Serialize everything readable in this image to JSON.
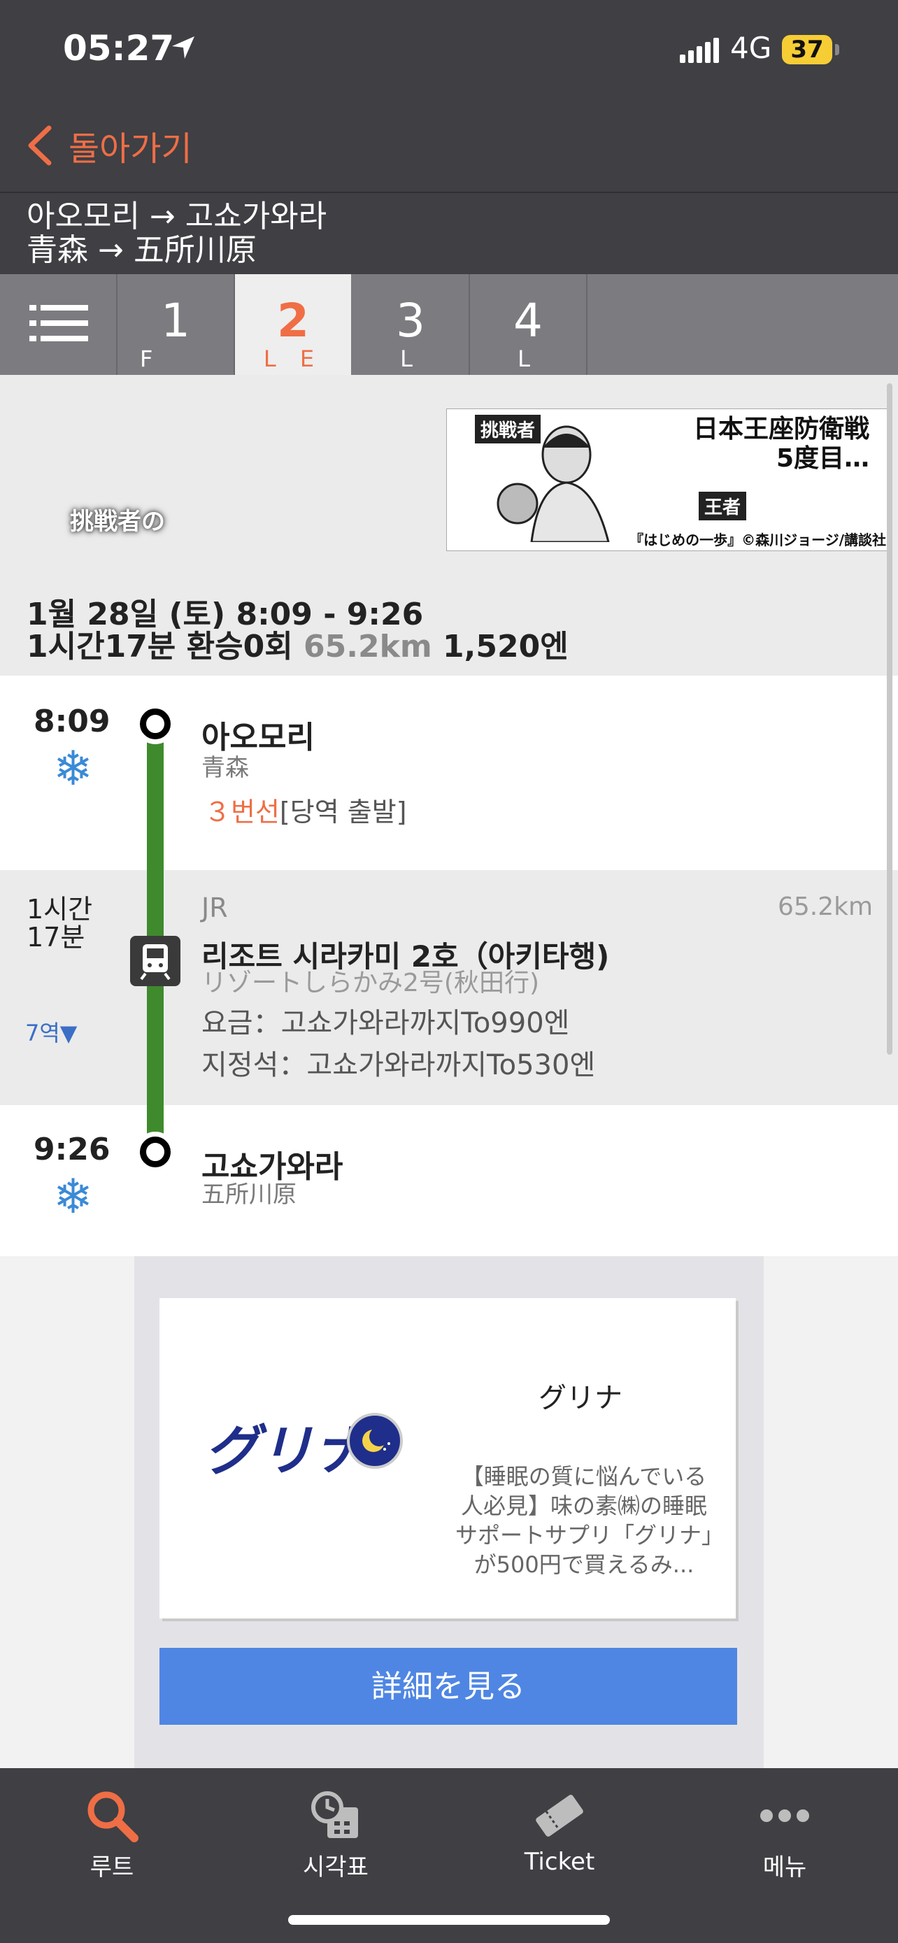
{
  "status_bar": {
    "time": "05:27",
    "network": "4G",
    "battery": "37"
  },
  "nav": {
    "back_label": "돌아가기"
  },
  "route_header": {
    "line_ko": "아오모리 → 고쇼가와라",
    "line_ja": "青森 → 五所川原"
  },
  "tabs": [
    {
      "num": "1",
      "sub": "F"
    },
    {
      "num": "2",
      "sub": "L E"
    },
    {
      "num": "3",
      "sub": "L"
    },
    {
      "num": "4",
      "sub": "L"
    }
  ],
  "active_tab": 2,
  "banner": {
    "tag_challenger": "挑戦者",
    "headline": "日本王座防衛戦\n5度目…",
    "tag_champion": "王者",
    "credit": "『はじめの一歩』©森川ジョージ/講談社",
    "overlay_text": "挑戦者の"
  },
  "summary": {
    "date_time": "1월 28일 (토)  8:09 -  9:26",
    "duration": "1시간17분",
    "transfers": "환승0회",
    "distance": "65.2km",
    "fare": "1,520엔"
  },
  "departure": {
    "time": "8:09",
    "weather_icon": "snowflake-icon",
    "station_ko": "아오모리",
    "station_ja": "青森",
    "platform_highlight": "３번선",
    "platform_note": "[당역 출발]"
  },
  "segment": {
    "duration_line1": "1시간",
    "duration_line2": "17분",
    "stops": "7역▼",
    "operator": "JR",
    "distance": "65.2km",
    "train_name": "리조트 시라카미 2호（아키타행)",
    "train_name_ja": "リゾートしらかみ2号(秋田行)",
    "fare": "요금：고쇼가와라까지To990엔",
    "reserved_seat": "지정석：고쇼가와라까지To530엔"
  },
  "arrival": {
    "time": "9:26",
    "weather_icon": "snowflake-icon",
    "station_ko": "고쇼가와라",
    "station_ja": "五所川原"
  },
  "ad": {
    "logo_text": "グリナ",
    "title": "グリナ",
    "description": "【睡眠の質に悩んでいる人必見】味の素㈱の睡眠サポートサプリ「グリナ」が500円で買えるみ...",
    "button": "詳細を見る"
  },
  "bottom_nav": [
    {
      "label": "루트",
      "icon": "search-icon"
    },
    {
      "label": "시각표",
      "icon": "timetable-icon"
    },
    {
      "label": "Ticket",
      "icon": "ticket-icon"
    },
    {
      "label": "메뉴",
      "icon": "more-icon"
    }
  ],
  "colors": {
    "accent": "#ef6e45",
    "route_line": "#3f8a2d",
    "ad_button": "#4f86e3",
    "bar_bg": "#3f3f44"
  }
}
